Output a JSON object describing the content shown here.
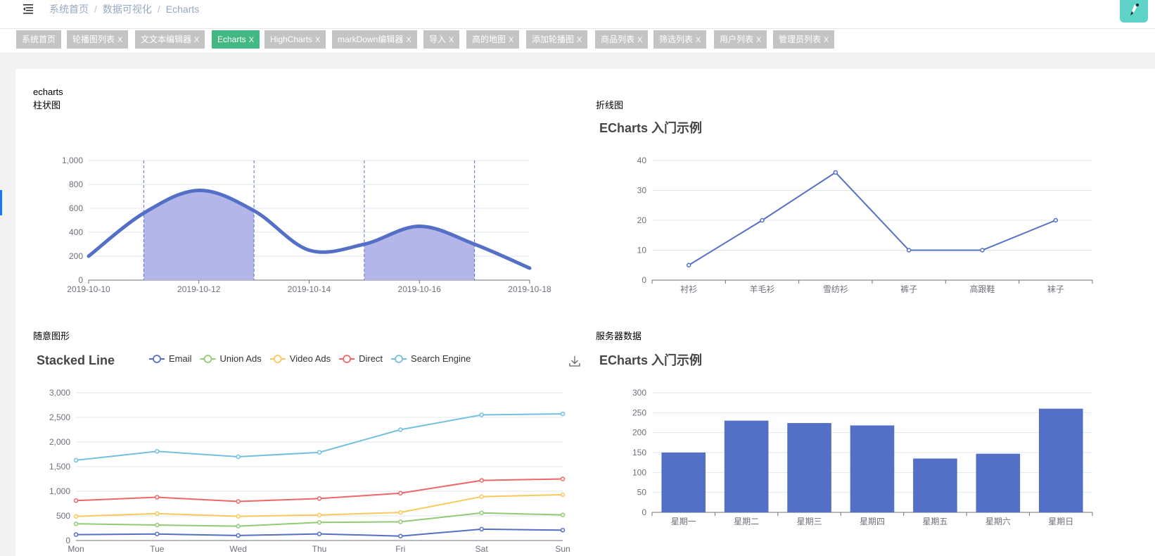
{
  "breadcrumb": [
    "系统首页",
    "数据可视化",
    "Echarts"
  ],
  "tabs": [
    {
      "label": "系统首页",
      "active": false,
      "closable": false
    },
    {
      "label": "轮播图列表",
      "active": false,
      "closable": true
    },
    {
      "label": "文文本编辑器",
      "active": false,
      "closable": true
    },
    {
      "label": "Echarts",
      "active": true,
      "closable": true
    },
    {
      "label": "HighCharts",
      "active": false,
      "closable": true
    },
    {
      "label": "markDown编辑器",
      "active": false,
      "closable": true
    },
    {
      "label": "导入",
      "active": false,
      "closable": true
    },
    {
      "label": "高的地图",
      "active": false,
      "closable": true
    },
    {
      "label": "添加轮播图",
      "active": false,
      "closable": true
    },
    {
      "label": "商品列表",
      "active": false,
      "closable": true
    },
    {
      "label": "筛选列表",
      "active": false,
      "closable": true
    },
    {
      "label": "用户列表",
      "active": false,
      "closable": true
    },
    {
      "label": "管理员列表",
      "active": false,
      "closable": true
    }
  ],
  "tab_close_glyph": "X",
  "sections": {
    "echarts_label": "echarts",
    "bar_label": "柱状图",
    "line_label": "折线图",
    "random_label": "随意图形",
    "server_label": "服务器数据"
  },
  "icons": {
    "menu": "menu-fold-icon",
    "download": "download-icon",
    "avatar": "avatar"
  },
  "colors": {
    "primary": "#5470c6",
    "tag_active": "#42b983",
    "tag": "#c4c4c4"
  },
  "chart_data": [
    {
      "type": "area",
      "x": [
        "2019-10-10",
        "2019-10-11",
        "2019-10-12",
        "2019-10-13",
        "2019-10-14",
        "2019-10-15",
        "2019-10-16",
        "2019-10-17",
        "2019-10-18"
      ],
      "x_tick_labels": [
        "2019-10-10",
        "2019-10-12",
        "2019-10-14",
        "2019-10-16",
        "2019-10-18"
      ],
      "values": [
        200,
        560,
        750,
        580,
        250,
        300,
        450,
        300,
        100
      ],
      "ylim": [
        0,
        1000
      ],
      "y_ticks": [
        "0",
        "200",
        "400",
        "600",
        "800",
        "1,000"
      ],
      "shaded_ranges": [
        [
          "2019-10-11",
          "2019-10-13"
        ],
        [
          "2019-10-15",
          "2019-10-17"
        ]
      ],
      "title": "",
      "xlabel": "",
      "ylabel": ""
    },
    {
      "type": "line",
      "title": "ECharts 入门示例",
      "categories": [
        "衬衫",
        "羊毛衫",
        "雪纺衫",
        "裤子",
        "高跟鞋",
        "袜子"
      ],
      "values": [
        5,
        20,
        36,
        10,
        10,
        20
      ],
      "ylim": [
        0,
        40
      ],
      "y_ticks": [
        "0",
        "10",
        "20",
        "30",
        "40"
      ]
    },
    {
      "type": "line",
      "title": "Stacked Line",
      "categories": [
        "Mon",
        "Tue",
        "Wed",
        "Thu",
        "Fri",
        "Sat",
        "Sun"
      ],
      "series": [
        {
          "name": "Email",
          "color": "#5470c6",
          "values": [
            120,
            132,
            101,
            134,
            90,
            230,
            210
          ]
        },
        {
          "name": "Union Ads",
          "color": "#91cc75",
          "values": [
            340,
            314,
            291,
            368,
            380,
            560,
            520
          ]
        },
        {
          "name": "Video Ads",
          "color": "#fac858",
          "values": [
            490,
            546,
            491,
            518,
            570,
            890,
            930
          ]
        },
        {
          "name": "Direct",
          "color": "#ee6666",
          "values": [
            810,
            878,
            792,
            852,
            960,
            1220,
            1250
          ]
        },
        {
          "name": "Search Engine",
          "color": "#73c0de",
          "values": [
            1630,
            1810,
            1700,
            1790,
            2250,
            2550,
            2570
          ]
        }
      ],
      "ylim": [
        0,
        3000
      ],
      "y_ticks": [
        "0",
        "500",
        "1,000",
        "1,500",
        "2,000",
        "2,500",
        "3,000"
      ]
    },
    {
      "type": "bar",
      "title": "ECharts 入门示例",
      "categories": [
        "星期一",
        "星期二",
        "星期三",
        "星期四",
        "星期五",
        "星期六",
        "星期日"
      ],
      "values": [
        150,
        230,
        224,
        218,
        135,
        147,
        260
      ],
      "ylim": [
        0,
        300
      ],
      "y_ticks": [
        "0",
        "50",
        "100",
        "150",
        "200",
        "250",
        "300"
      ]
    }
  ]
}
